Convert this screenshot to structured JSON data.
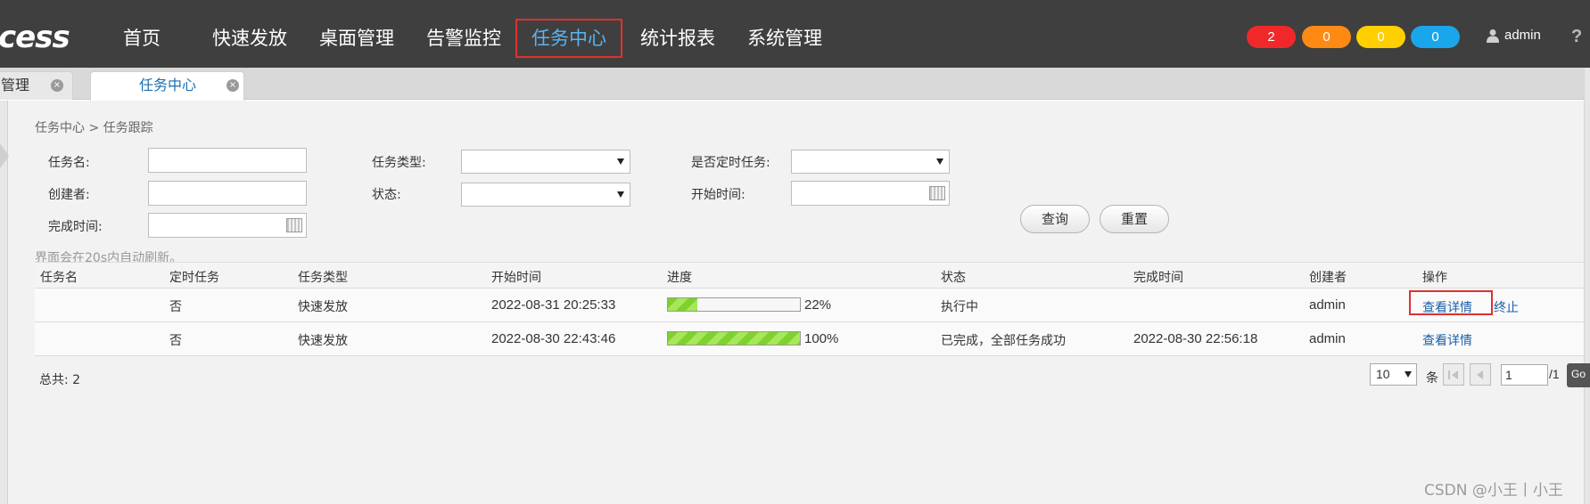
{
  "app": {
    "logo_text": "cess",
    "nav": [
      {
        "label": "首页"
      },
      {
        "label": "快速发放"
      },
      {
        "label": "桌面管理"
      },
      {
        "label": "告警监控"
      },
      {
        "label": "任务中心",
        "active": true
      },
      {
        "label": "统计报表"
      },
      {
        "label": "系统管理"
      }
    ],
    "alerts": [
      {
        "count": "2",
        "color": "#f0282a"
      },
      {
        "count": "0",
        "color": "#ff8a13"
      },
      {
        "count": "0",
        "color": "#ffcf00"
      },
      {
        "count": "0",
        "color": "#1aa6ea"
      }
    ],
    "user": "admin",
    "help": "?"
  },
  "tabs": [
    {
      "label": "管理",
      "close": "×"
    },
    {
      "label": "任务中心",
      "close": "×",
      "active": true
    }
  ],
  "breadcrumb": "任务中心 > 任务跟踪",
  "filters": {
    "task_name_label": "任务名:",
    "task_type_label": "任务类型:",
    "scheduled_label": "是否定时任务:",
    "creator_label": "创建者:",
    "status_label": "状态:",
    "start_time_label": "开始时间:",
    "finish_time_label": "完成时间:",
    "query_button": "查询",
    "reset_button": "重置"
  },
  "refresh_note": "界面会在20s内自动刷新。",
  "table": {
    "headers": [
      "任务名",
      "定时任务",
      "任务类型",
      "开始时间",
      "进度",
      "状态",
      "完成时间",
      "创建者",
      "操作"
    ],
    "rows": [
      {
        "name": "",
        "scheduled": "否",
        "type": "快速发放",
        "start": "2022-08-31 20:25:33",
        "progress": 22,
        "progress_text": "22%",
        "status": "执行中",
        "finish": "",
        "creator": "admin",
        "action_detail": "查看详情",
        "action_stop": "终止"
      },
      {
        "name": "",
        "scheduled": "否",
        "type": "快速发放",
        "start": "2022-08-30 22:43:46",
        "progress": 100,
        "progress_text": "100%",
        "status": "已完成，全部任务成功",
        "finish": "2022-08-30 22:56:18",
        "creator": "admin",
        "action_detail": "查看详情",
        "action_stop": ""
      }
    ]
  },
  "pager": {
    "total": "总共: 2",
    "page_size": "10",
    "unit": "条",
    "page": "1",
    "pages": "/1",
    "go": "Go"
  },
  "watermark": "CSDN @小王丨小王"
}
